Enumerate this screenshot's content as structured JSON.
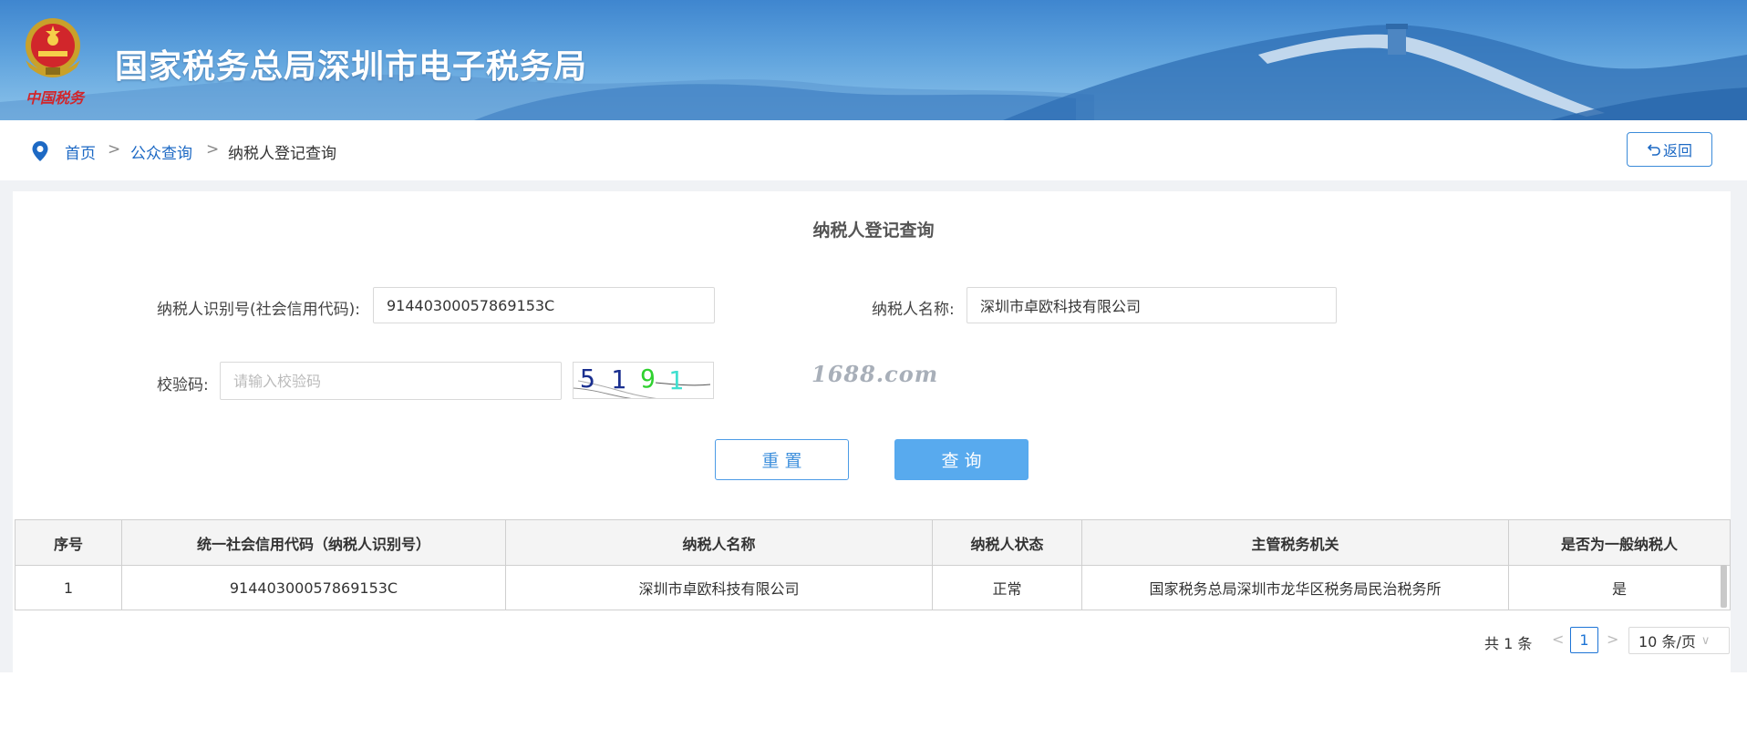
{
  "banner": {
    "title": "国家税务总局深圳市电子税务局",
    "emblem_caption": "中国税务"
  },
  "breadcrumb": {
    "home": "首页",
    "separator": ">",
    "public_query": "公众查询",
    "current": "纳税人登记查询"
  },
  "back_button": {
    "label": "返回",
    "icon": "return-arrow-icon"
  },
  "page_title": "纳税人登记查询",
  "form": {
    "taxpayer_id_label": "纳税人识别号(社会信用代码):",
    "taxpayer_id_value": "91440300057869153C",
    "taxpayer_name_label": "纳税人名称:",
    "taxpayer_name_value": "深圳市卓欧科技有限公司",
    "captcha_label": "校验码:",
    "captcha_placeholder": "请输入校验码",
    "captcha_digits": [
      "5",
      "1",
      "9",
      "1"
    ],
    "captcha_colors": [
      "#1a2f8f",
      "#1a2f8f",
      "#2fd12f",
      "#40e0d0"
    ]
  },
  "watermark": "1688.com",
  "buttons": {
    "reset": "重置",
    "query": "查询"
  },
  "table": {
    "headers": [
      "序号",
      "统一社会信用代码（纳税人识别号）",
      "纳税人名称",
      "纳税人状态",
      "主管税务机关",
      "是否为一般纳税人"
    ],
    "rows": [
      [
        "1",
        "91440300057869153C",
        "深圳市卓欧科技有限公司",
        "正常",
        "国家税务总局深圳市龙华区税务局民治税务所",
        "是"
      ]
    ]
  },
  "pagination": {
    "total": "共 1 条",
    "current_page": "1",
    "page_size": "10 条/页",
    "prev_icon": "chevron-left-icon",
    "next_icon": "chevron-right-icon"
  },
  "colors": {
    "brand_blue": "#1d69c4",
    "query_button": "#58aaee",
    "banner_top": "#3f86cf"
  }
}
